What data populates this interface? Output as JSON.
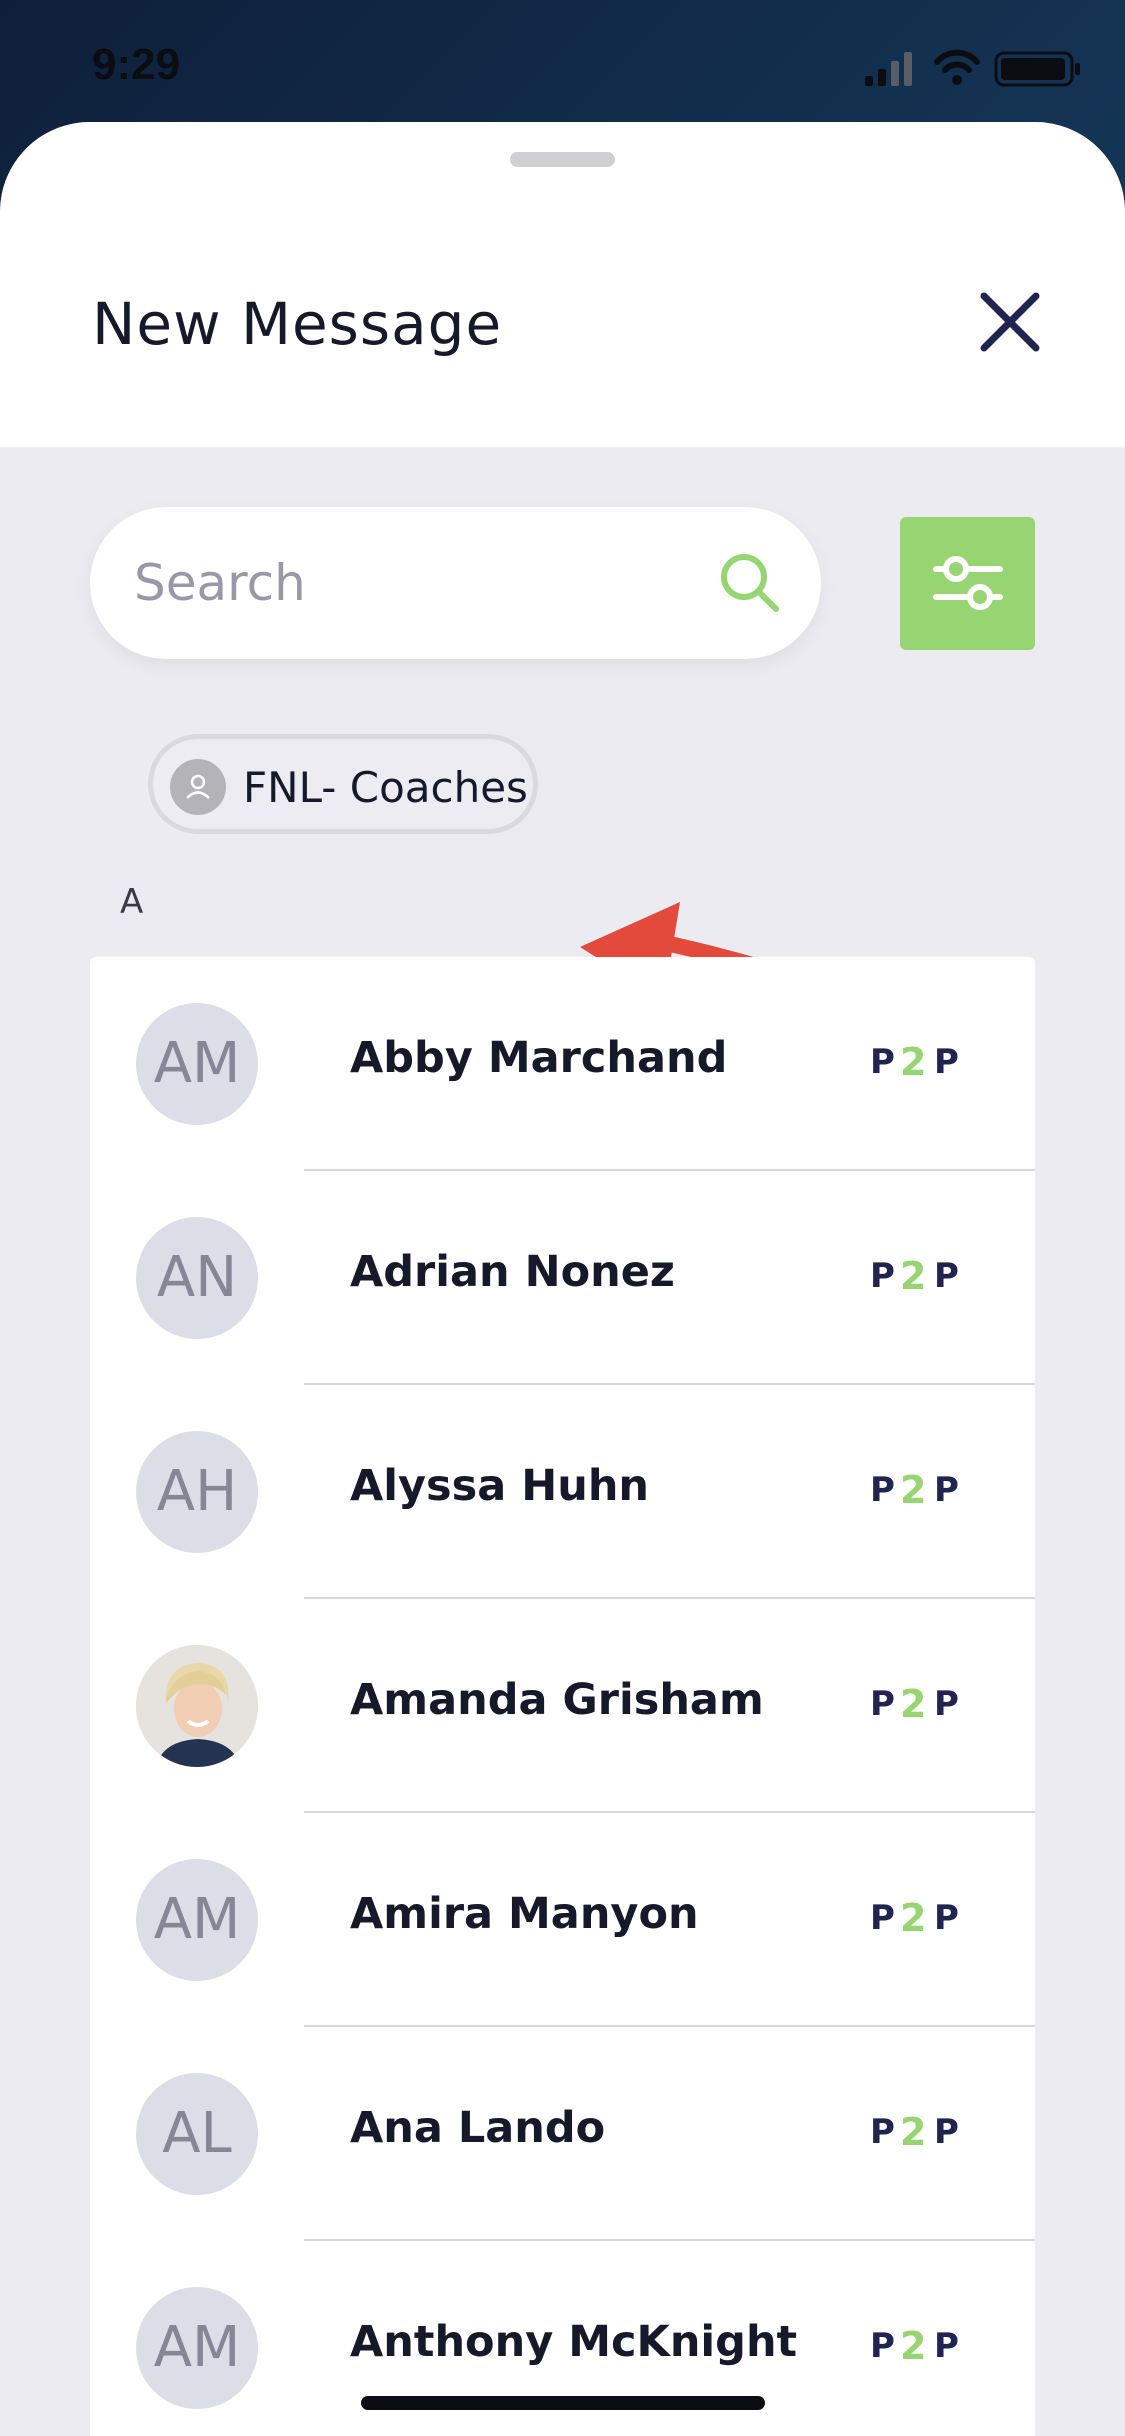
{
  "status_bar": {
    "time": "9:29",
    "signal_icon": "cellular-signal-icon",
    "wifi_icon": "wifi-icon",
    "battery_icon": "battery-icon"
  },
  "header": {
    "title": "New Message",
    "close_icon": "close-icon"
  },
  "search": {
    "placeholder": "Search",
    "value": "",
    "icon": "search-icon"
  },
  "filter_button": {
    "icon": "sliders-icon",
    "color": "#97d572"
  },
  "selected_chip": {
    "label": "FNL- Coaches",
    "icon": "person-icon"
  },
  "annotation": {
    "icon": "red-arrow-icon",
    "color": "#e34a3c"
  },
  "section": {
    "letter": "A"
  },
  "contacts": [
    {
      "initials": "AM",
      "name": "Abby Marchand",
      "has_photo": false
    },
    {
      "initials": "AN",
      "name": "Adrian Nonez",
      "has_photo": false
    },
    {
      "initials": "AH",
      "name": "Alyssa Huhn",
      "has_photo": false
    },
    {
      "initials": "",
      "name": "Amanda Grisham",
      "has_photo": true
    },
    {
      "initials": "AM",
      "name": "Amira Manyon",
      "has_photo": false
    },
    {
      "initials": "AL",
      "name": "Ana Lando",
      "has_photo": false
    },
    {
      "initials": "AM",
      "name": "Anthony McKnight",
      "has_photo": false
    }
  ],
  "brand": {
    "logo_icon": "p2p-logo-icon",
    "navy": "#1f2550",
    "green": "#97d572"
  }
}
